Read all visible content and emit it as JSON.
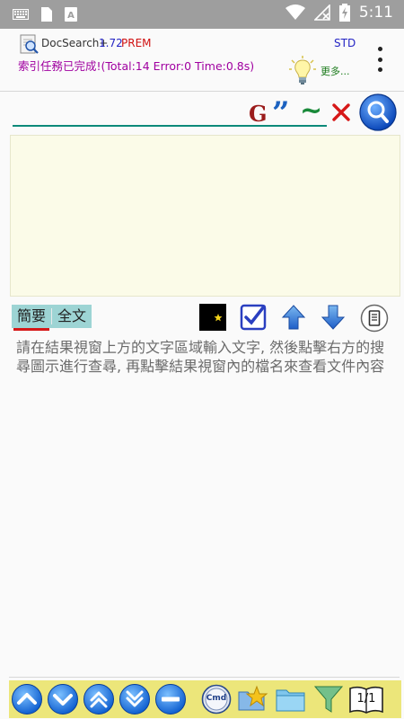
{
  "status_bar": {
    "time": "5:11",
    "icons": [
      "keyboard-icon",
      "sim-card-icon",
      "a-notification-icon",
      "wifi-icon",
      "no-signal-icon",
      "battery-charging-icon"
    ]
  },
  "header": {
    "app_name": "DocSearch+",
    "version": "1.72",
    "edition": "PREM",
    "mode": "STD",
    "status_message": "索引任務已完成!(Total:14 Error:0 Time:0.8s)",
    "more_label": "更多..."
  },
  "search": {
    "value": "",
    "placeholder": "",
    "buttons": [
      "google-icon",
      "quote-icon",
      "tilde-icon",
      "clear-icon",
      "search-icon"
    ]
  },
  "results": {
    "items": []
  },
  "tabs": [
    {
      "label": "簡要",
      "active": true
    },
    {
      "label": "全文",
      "active": false
    }
  ],
  "preview_text": "請在結果視窗上方的文字區域輸入文字, 然後點擊右方的搜尋圖示進行查尋, 再點擊結果視窗內的檔名來查看文件內容",
  "toolbar_icons": [
    "night-mode-icon",
    "checkbox-icon",
    "arrow-up-icon",
    "arrow-down-icon",
    "reader-icon"
  ],
  "bottom_bar": {
    "cmd_label": "Cmd",
    "page_indicator": "1/1",
    "icons": [
      "page-up-icon",
      "page-down-icon",
      "prev-hit-icon",
      "next-hit-icon",
      "collapse-icon",
      "cmd-icon",
      "favorites-icon",
      "folder-icon",
      "filter-icon",
      "book-icon"
    ]
  },
  "colors": {
    "status_bar": "#9e9e9e",
    "status_message": "#a000a0",
    "results_bg": "#fbfbe8",
    "tab_bg": "#9dd4d4",
    "bottom_bar": "#ece67a",
    "search_underline": "#0d8a7a"
  }
}
